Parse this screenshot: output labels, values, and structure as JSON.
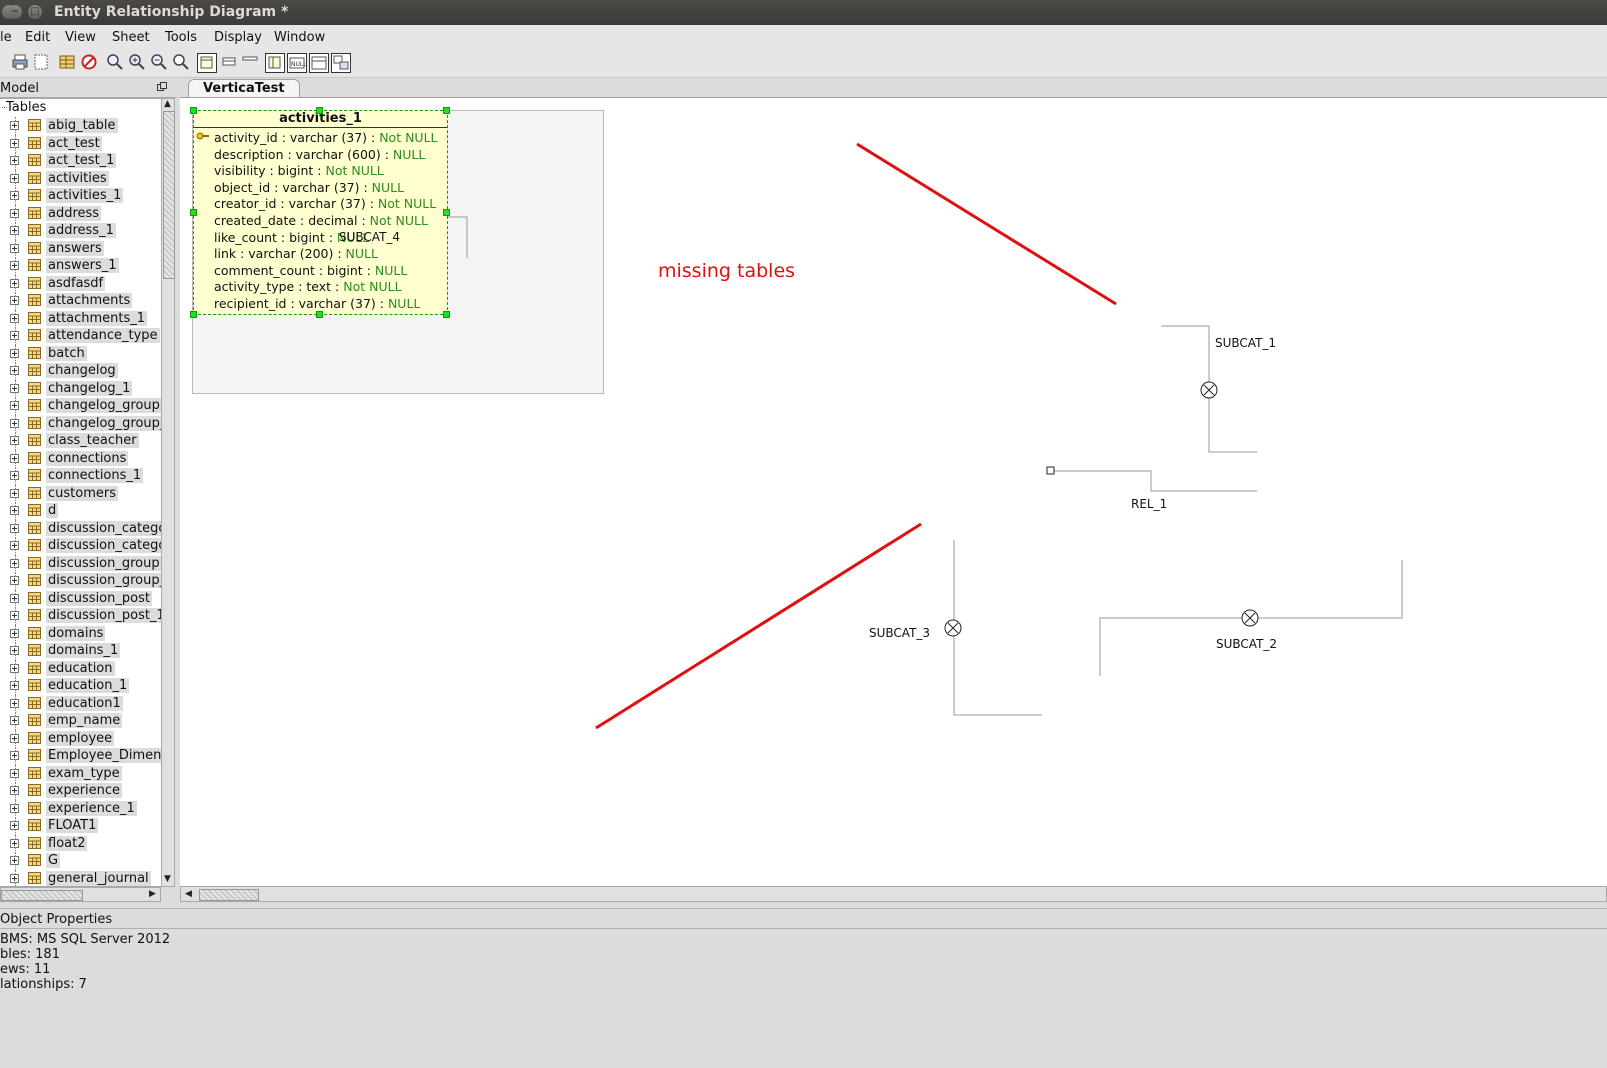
{
  "window": {
    "title": "Entity Relationship Diagram *",
    "controls": [
      "close-icon",
      "minimize-icon",
      "maximize-icon"
    ]
  },
  "menu": [
    "le",
    "Edit",
    "View",
    "Sheet",
    "Tools",
    "Display",
    "Window"
  ],
  "toolbar": {
    "icons": [
      "print-icon",
      "page-setup-icon",
      "table-properties-icon",
      "stop-icon",
      "zoom-fit-icon",
      "zoom-in-icon",
      "zoom-out-icon",
      "zoom-reset-icon",
      "display-mode-1-icon",
      "display-mode-2-icon",
      "display-mode-3-icon",
      "view-1-icon",
      "view-null-icon",
      "view-3-icon",
      "view-4-icon"
    ]
  },
  "model_panel": {
    "title": "Model",
    "root": "Tables",
    "tables": [
      "abig_table",
      "act_test",
      "act_test_1",
      "activities",
      "activities_1",
      "address",
      "address_1",
      "answers",
      "answers_1",
      "asdfasdf",
      "attachments",
      "attachments_1",
      "attendance_type",
      "batch",
      "changelog",
      "changelog_1",
      "changelog_group",
      "changelog_group_",
      "class_teacher",
      "connections",
      "connections_1",
      "customers",
      "d",
      "discussion_catego",
      "discussion_catego",
      "discussion_group",
      "discussion_group_",
      "discussion_post",
      "discussion_post_1",
      "domains",
      "domains_1",
      "education",
      "education_1",
      "education1",
      "emp_name",
      "employee",
      "Employee_Dimensi",
      "exam_type",
      "experience",
      "experience_1",
      "FLOAT1",
      "float2",
      "G",
      "general_journal"
    ]
  },
  "tab": {
    "label": "VerticaTest"
  },
  "entity": {
    "name": "activities_1",
    "columns": [
      {
        "name": "activity_id : varchar (37) : ",
        "null": "Not NULL"
      },
      {
        "name": "description : varchar (600) : ",
        "null": "NULL"
      },
      {
        "name": "visibility : bigint : ",
        "null": "Not NULL"
      },
      {
        "name": "object_id : varchar (37) : ",
        "null": "NULL"
      },
      {
        "name": "creator_id : varchar (37) : ",
        "null": "Not NULL"
      },
      {
        "name": "created_date : decimal : ",
        "null": "Not NULL"
      },
      {
        "name": "like_count : bigint : ",
        "null": "NULL"
      },
      {
        "name": "link : varchar (200) : ",
        "null": "NULL"
      },
      {
        "name": "comment_count : bigint : ",
        "null": "NULL"
      },
      {
        "name": "activity_type : text : ",
        "null": "Not NULL"
      },
      {
        "name": "recipient_id : varchar (37) : ",
        "null": "NULL"
      }
    ]
  },
  "diagram_labels": {
    "subcat_4": "SUBCAT_4",
    "subcat_1": "SUBCAT_1",
    "rel_1": "REL_1",
    "subcat_3": "SUBCAT_3",
    "subcat_2": "SUBCAT_2"
  },
  "annotation": {
    "text": "missing tables",
    "color": "#e01010"
  },
  "properties": {
    "title": "Object Properties",
    "lines": [
      "BMS: MS SQL Server 2012",
      "bles: 181",
      "ews: 11",
      "lationships: 7"
    ]
  },
  "colors": {
    "entity_fill": "#ffffd0",
    "selection_handle": "#22dd22",
    "null_text": "#2e8b22",
    "annotation": "#e01010"
  }
}
